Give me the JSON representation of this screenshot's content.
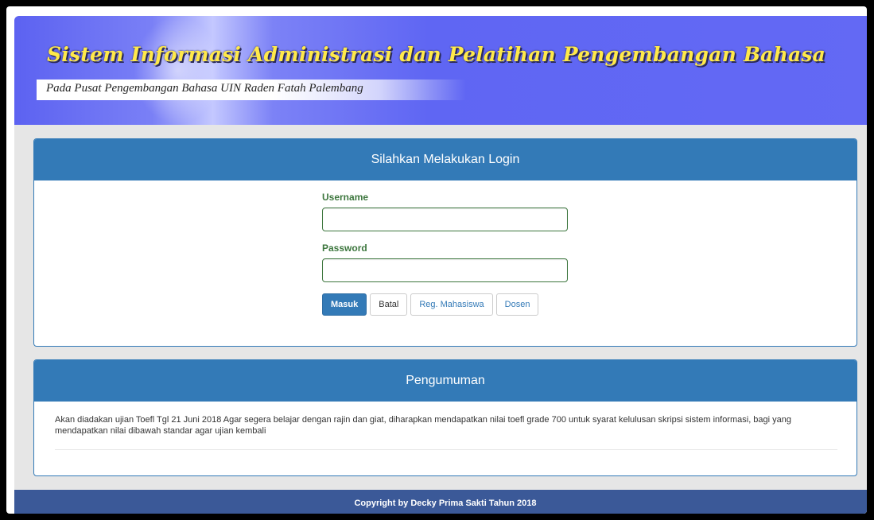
{
  "banner": {
    "title": "Sistem Informasi Administrasi dan Pelatihan Pengembangan Bahasa",
    "subtitle": "Pada Pusat Pengembangan Bahasa UIN Raden  Fatah Palembang"
  },
  "login": {
    "heading": "Silahkan Melakukan Login",
    "username_label": "Username",
    "username_value": "",
    "password_label": "Password",
    "password_value": "",
    "buttons": {
      "masuk": "Masuk",
      "batal": "Batal",
      "reg_mahasiswa": "Reg. Mahasiswa",
      "dosen": "Dosen"
    }
  },
  "announcement": {
    "heading": "Pengumuman",
    "text": "Akan diadakan ujian Toefl Tgl 21 Juni 2018 Agar segera belajar dengan rajin dan giat, diharapkan mendapatkan nilai toefl grade 700 untuk syarat kelulusan skripsi sistem informasi, bagi yang mendapatkan nilai dibawah standar agar ujian kembali"
  },
  "footer": {
    "text": "Copyright by Decky Prima Sakti Tahun 2018"
  },
  "colors": {
    "banner": "#6369f4",
    "title_text": "#ffe94a",
    "panel_header": "#337ab7",
    "field_border": "#3c763d",
    "footer": "#3b5998"
  }
}
